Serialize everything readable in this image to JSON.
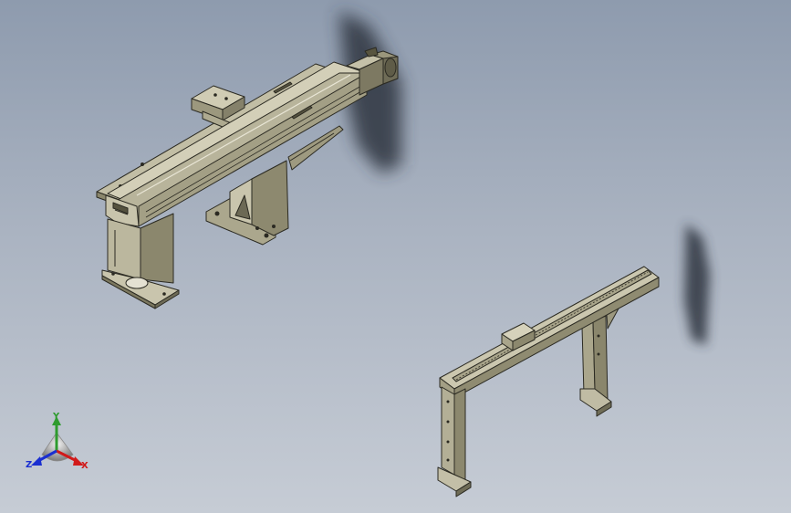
{
  "viewport": {
    "background_top": "#8e9bae",
    "background_bottom": "#c6ccd5"
  },
  "model": {
    "part_color": "#b6b197",
    "part_dark": "#7f7b64",
    "part_light": "#d6d2bb",
    "edge_color": "#2b2a22",
    "shadow_color": "#303743"
  },
  "triad": {
    "x_label": "X",
    "y_label": "Y",
    "z_label": "Z",
    "x_color": "#d11a1a",
    "y_color": "#2e9b2e",
    "z_color": "#1a2fd1"
  }
}
